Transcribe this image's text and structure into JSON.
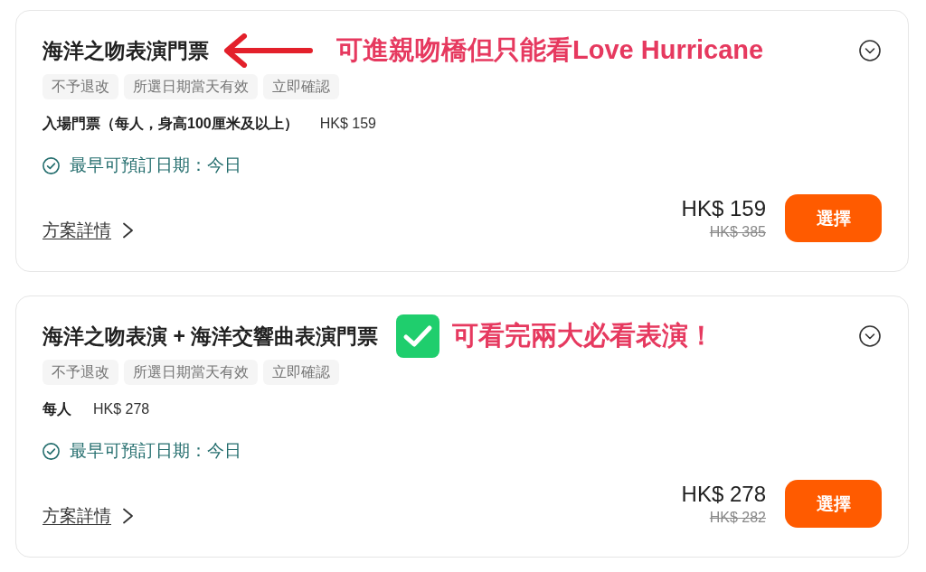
{
  "cards": [
    {
      "title": "海洋之吻表演門票",
      "annotation": {
        "kind": "arrow",
        "text": "可進親吻橋但只能看Love Hurricane"
      },
      "tags": [
        "不予退改",
        "所選日期當天有效",
        "立即確認"
      ],
      "package": {
        "name": "入場門票（每人，身高100厘米及以上）",
        "price": "HK$ 159"
      },
      "availability": "最早可預訂日期：今日",
      "details_link": "方案詳情",
      "price": "HK$ 159",
      "original_price": "HK$ 385",
      "select_button": "選擇"
    },
    {
      "title": "海洋之吻表演 + 海洋交響曲表演門票",
      "annotation": {
        "kind": "check",
        "text": "可看完兩大必看表演！"
      },
      "tags": [
        "不予退改",
        "所選日期當天有效",
        "立即確認"
      ],
      "package": {
        "name": "每人",
        "price": "HK$ 278"
      },
      "availability": "最早可預訂日期：今日",
      "details_link": "方案詳情",
      "price": "HK$ 278",
      "original_price": "HK$ 282",
      "select_button": "選擇"
    }
  ]
}
